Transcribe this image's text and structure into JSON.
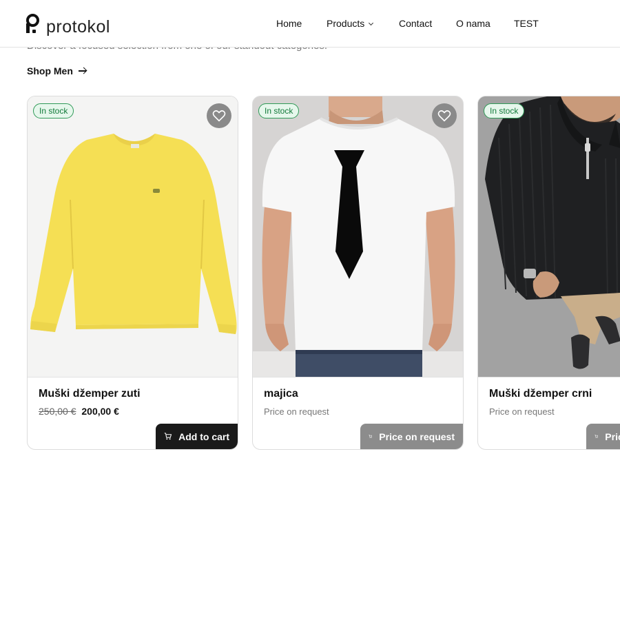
{
  "header": {
    "logo_text": "protokol",
    "nav": [
      {
        "label": "Home"
      },
      {
        "label": "Products"
      },
      {
        "label": "Contact"
      },
      {
        "label": "O nama"
      },
      {
        "label": "TEST"
      }
    ]
  },
  "intro": {
    "text": "Discover a focused selection from one of our standout categories.",
    "shop_link": "Shop Men"
  },
  "colors": {
    "accent_dark": "#1a1a1a",
    "button_gray": "#8c8c8c",
    "stock_green": "#127a3a"
  },
  "products": [
    {
      "badge": "In stock",
      "title": "Muški džemper zuti",
      "old_price": "250,00 €",
      "price": "200,00 €",
      "button": "Add to cart",
      "image": "yellow-sweater"
    },
    {
      "badge": "In stock",
      "title": "majica",
      "price_text": "Price on request",
      "button": "Price on request",
      "image": "white-tshirt-with-tie"
    },
    {
      "badge": "In stock",
      "title": "Muški džemper crni",
      "price_text": "Price on request",
      "button": "Price on request",
      "image": "black-knit-sweater"
    }
  ]
}
